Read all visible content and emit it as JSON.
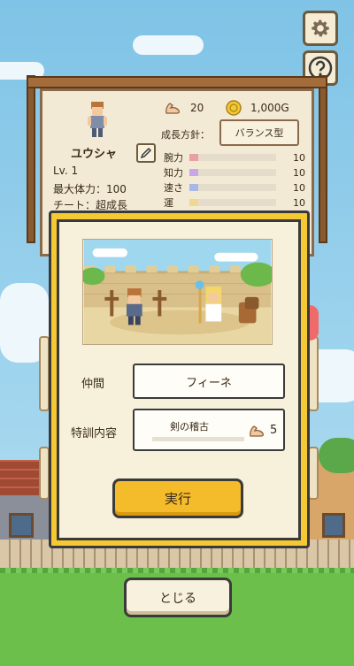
{
  "icons": {
    "settings": "gear-icon",
    "help": "question-icon",
    "strength": "muscle-arm-icon",
    "gold": "gold-coin-icon",
    "edit": "pencil-icon"
  },
  "hero": {
    "name": "ユウシャ",
    "level": "Lv. 1",
    "max_hp": "最大体力：100",
    "cheat": "チート：超成長"
  },
  "resources": {
    "strength_points": "20",
    "gold": "1,000G"
  },
  "growth_policy": {
    "label": "成長方針：",
    "value": "バランス型"
  },
  "stats": [
    {
      "name": "腕力",
      "value": "10",
      "color": "#e8a0a0",
      "fill": 0.1
    },
    {
      "name": "知力",
      "value": "10",
      "color": "#c6a8e6",
      "fill": 0.1
    },
    {
      "name": "速さ",
      "value": "10",
      "color": "#a8b8e6",
      "fill": 0.1
    },
    {
      "name": "運",
      "value": "10",
      "color": "#f0d890",
      "fill": 0.1
    }
  ],
  "training": {
    "companion_label": "仲間",
    "companion_value": "フィーネ",
    "content_label": "特訓内容",
    "content_value": "剣の稽古",
    "content_cost": "5",
    "execute_label": "実行"
  },
  "close_label": "とじる",
  "colors": {
    "dialog_frame": "#f4c934",
    "execute_button": "#f4bb2a",
    "board": "#f3ead6"
  }
}
